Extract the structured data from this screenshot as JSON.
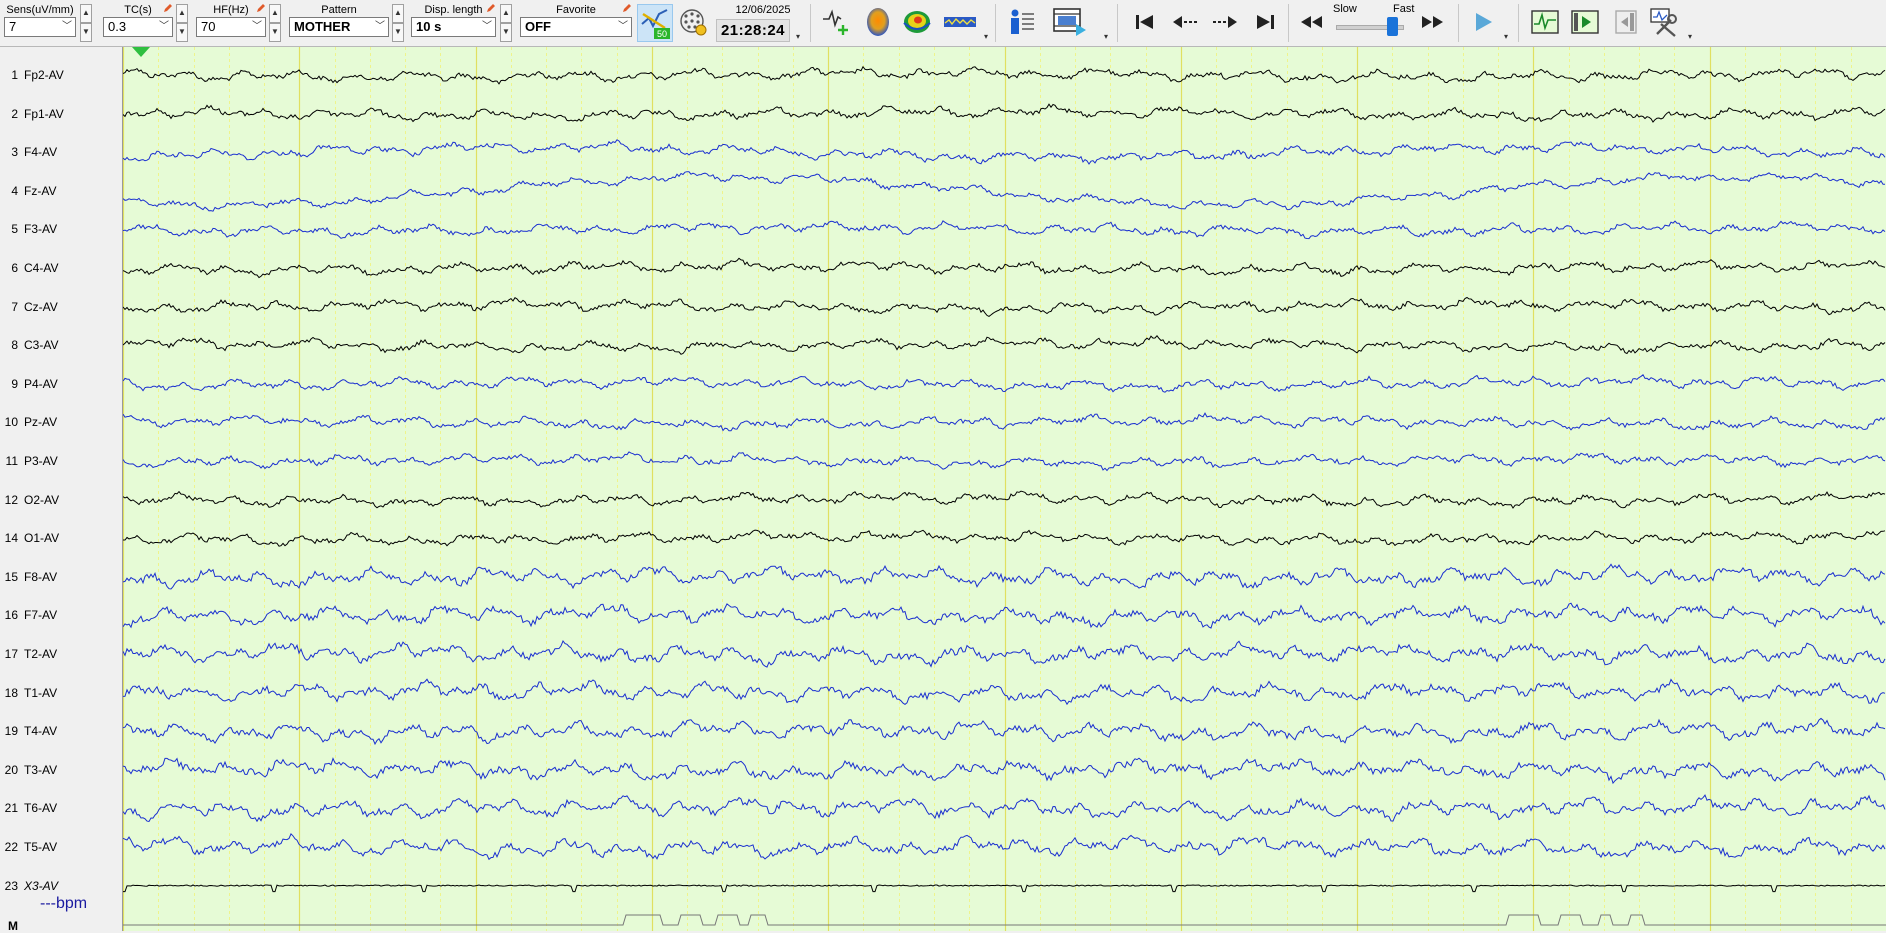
{
  "toolbar": {
    "sensitivity": {
      "label": "Sens(uV/mm)",
      "value": "7"
    },
    "time_constant": {
      "label": "TC(s)",
      "value": "0.3"
    },
    "high_filter": {
      "label": "HF(Hz)",
      "value": "70"
    },
    "pattern": {
      "label": "Pattern",
      "value": "MOTHER"
    },
    "display_length": {
      "label": "Disp. length",
      "value": "10 s"
    },
    "favorite": {
      "label": "Favorite",
      "value": "OFF"
    },
    "date": "12/06/2025",
    "time": "21:28:24",
    "notch_badge": "50",
    "speed": {
      "slow_label": "Slow",
      "fast_label": "Fast",
      "level": 0.85
    }
  },
  "channels": [
    {
      "num": "1",
      "name": "Fp2-AV",
      "color": "#000000"
    },
    {
      "num": "2",
      "name": "Fp1-AV",
      "color": "#000000"
    },
    {
      "num": "3",
      "name": "F4-AV",
      "color": "#1a2fd0"
    },
    {
      "num": "4",
      "name": "Fz-AV",
      "color": "#1a2fd0"
    },
    {
      "num": "5",
      "name": "F3-AV",
      "color": "#1a2fd0"
    },
    {
      "num": "6",
      "name": "C4-AV",
      "color": "#000000"
    },
    {
      "num": "7",
      "name": "Cz-AV",
      "color": "#000000"
    },
    {
      "num": "8",
      "name": "C3-AV",
      "color": "#000000"
    },
    {
      "num": "9",
      "name": "P4-AV",
      "color": "#1a2fd0"
    },
    {
      "num": "10",
      "name": "Pz-AV",
      "color": "#1a2fd0"
    },
    {
      "num": "11",
      "name": "P3-AV",
      "color": "#1a2fd0"
    },
    {
      "num": "12",
      "name": "O2-AV",
      "color": "#000000"
    },
    {
      "num": "14",
      "name": "O1-AV",
      "color": "#000000"
    },
    {
      "num": "15",
      "name": "F8-AV",
      "color": "#1a2fd0"
    },
    {
      "num": "16",
      "name": "F7-AV",
      "color": "#1a2fd0"
    },
    {
      "num": "17",
      "name": "T2-AV",
      "color": "#1a2fd0"
    },
    {
      "num": "18",
      "name": "T1-AV",
      "color": "#1a2fd0"
    },
    {
      "num": "19",
      "name": "T4-AV",
      "color": "#1a2fd0"
    },
    {
      "num": "20",
      "name": "T3-AV",
      "color": "#1a2fd0"
    },
    {
      "num": "21",
      "name": "T6-AV",
      "color": "#1a2fd0"
    },
    {
      "num": "22",
      "name": "T5-AV",
      "color": "#1a2fd0"
    },
    {
      "num": "23",
      "name": "X3-AV",
      "color": "#000000"
    }
  ],
  "heart_rate": "---bpm",
  "marker_channel": "M",
  "colors": {
    "trace_background": "#e6fbd6",
    "second_gridline": "#e0e060",
    "sub_gridline": "#f2f27a",
    "cursor": "#2fbf40"
  }
}
